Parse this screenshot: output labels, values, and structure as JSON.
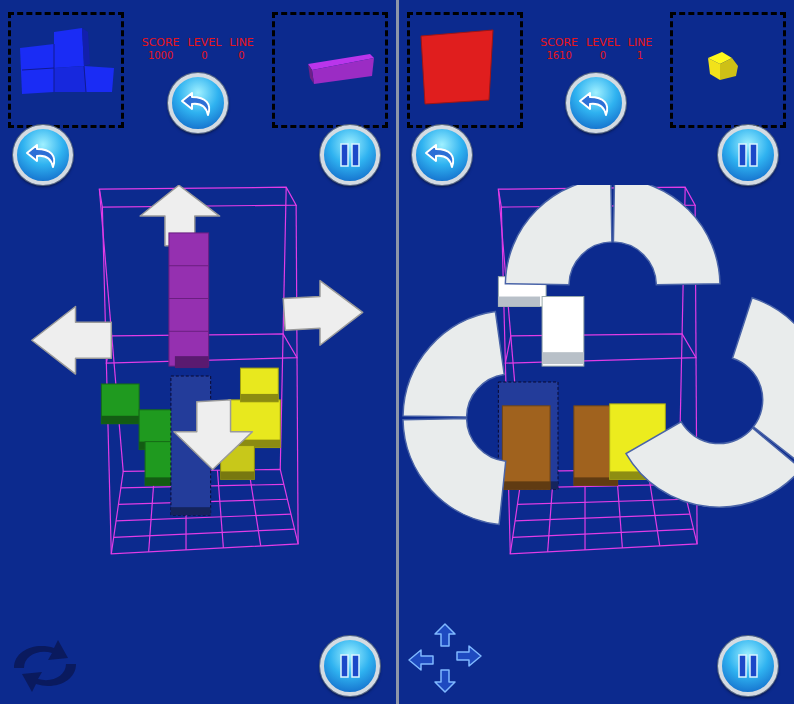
{
  "panels": [
    {
      "stats": [
        {
          "label": "SCORE",
          "value": "1000"
        },
        {
          "label": "LEVEL",
          "value": "0"
        },
        {
          "label": "LINE",
          "value": "0"
        }
      ],
      "hold_piece": {
        "kind": "tee",
        "color": "#1a2cf5"
      },
      "next_piece": {
        "kind": "bar",
        "color": "#9b2cc4"
      },
      "controls": {
        "kind": "move"
      }
    },
    {
      "stats": [
        {
          "label": "SCORE",
          "value": "1610"
        },
        {
          "label": "LEVEL",
          "value": "0"
        },
        {
          "label": "LINE",
          "value": "1"
        }
      ],
      "hold_piece": {
        "kind": "cube",
        "color": "#e01e1e"
      },
      "next_piece": {
        "kind": "small",
        "color": "#f2e21a"
      },
      "controls": {
        "kind": "rotate"
      }
    }
  ]
}
